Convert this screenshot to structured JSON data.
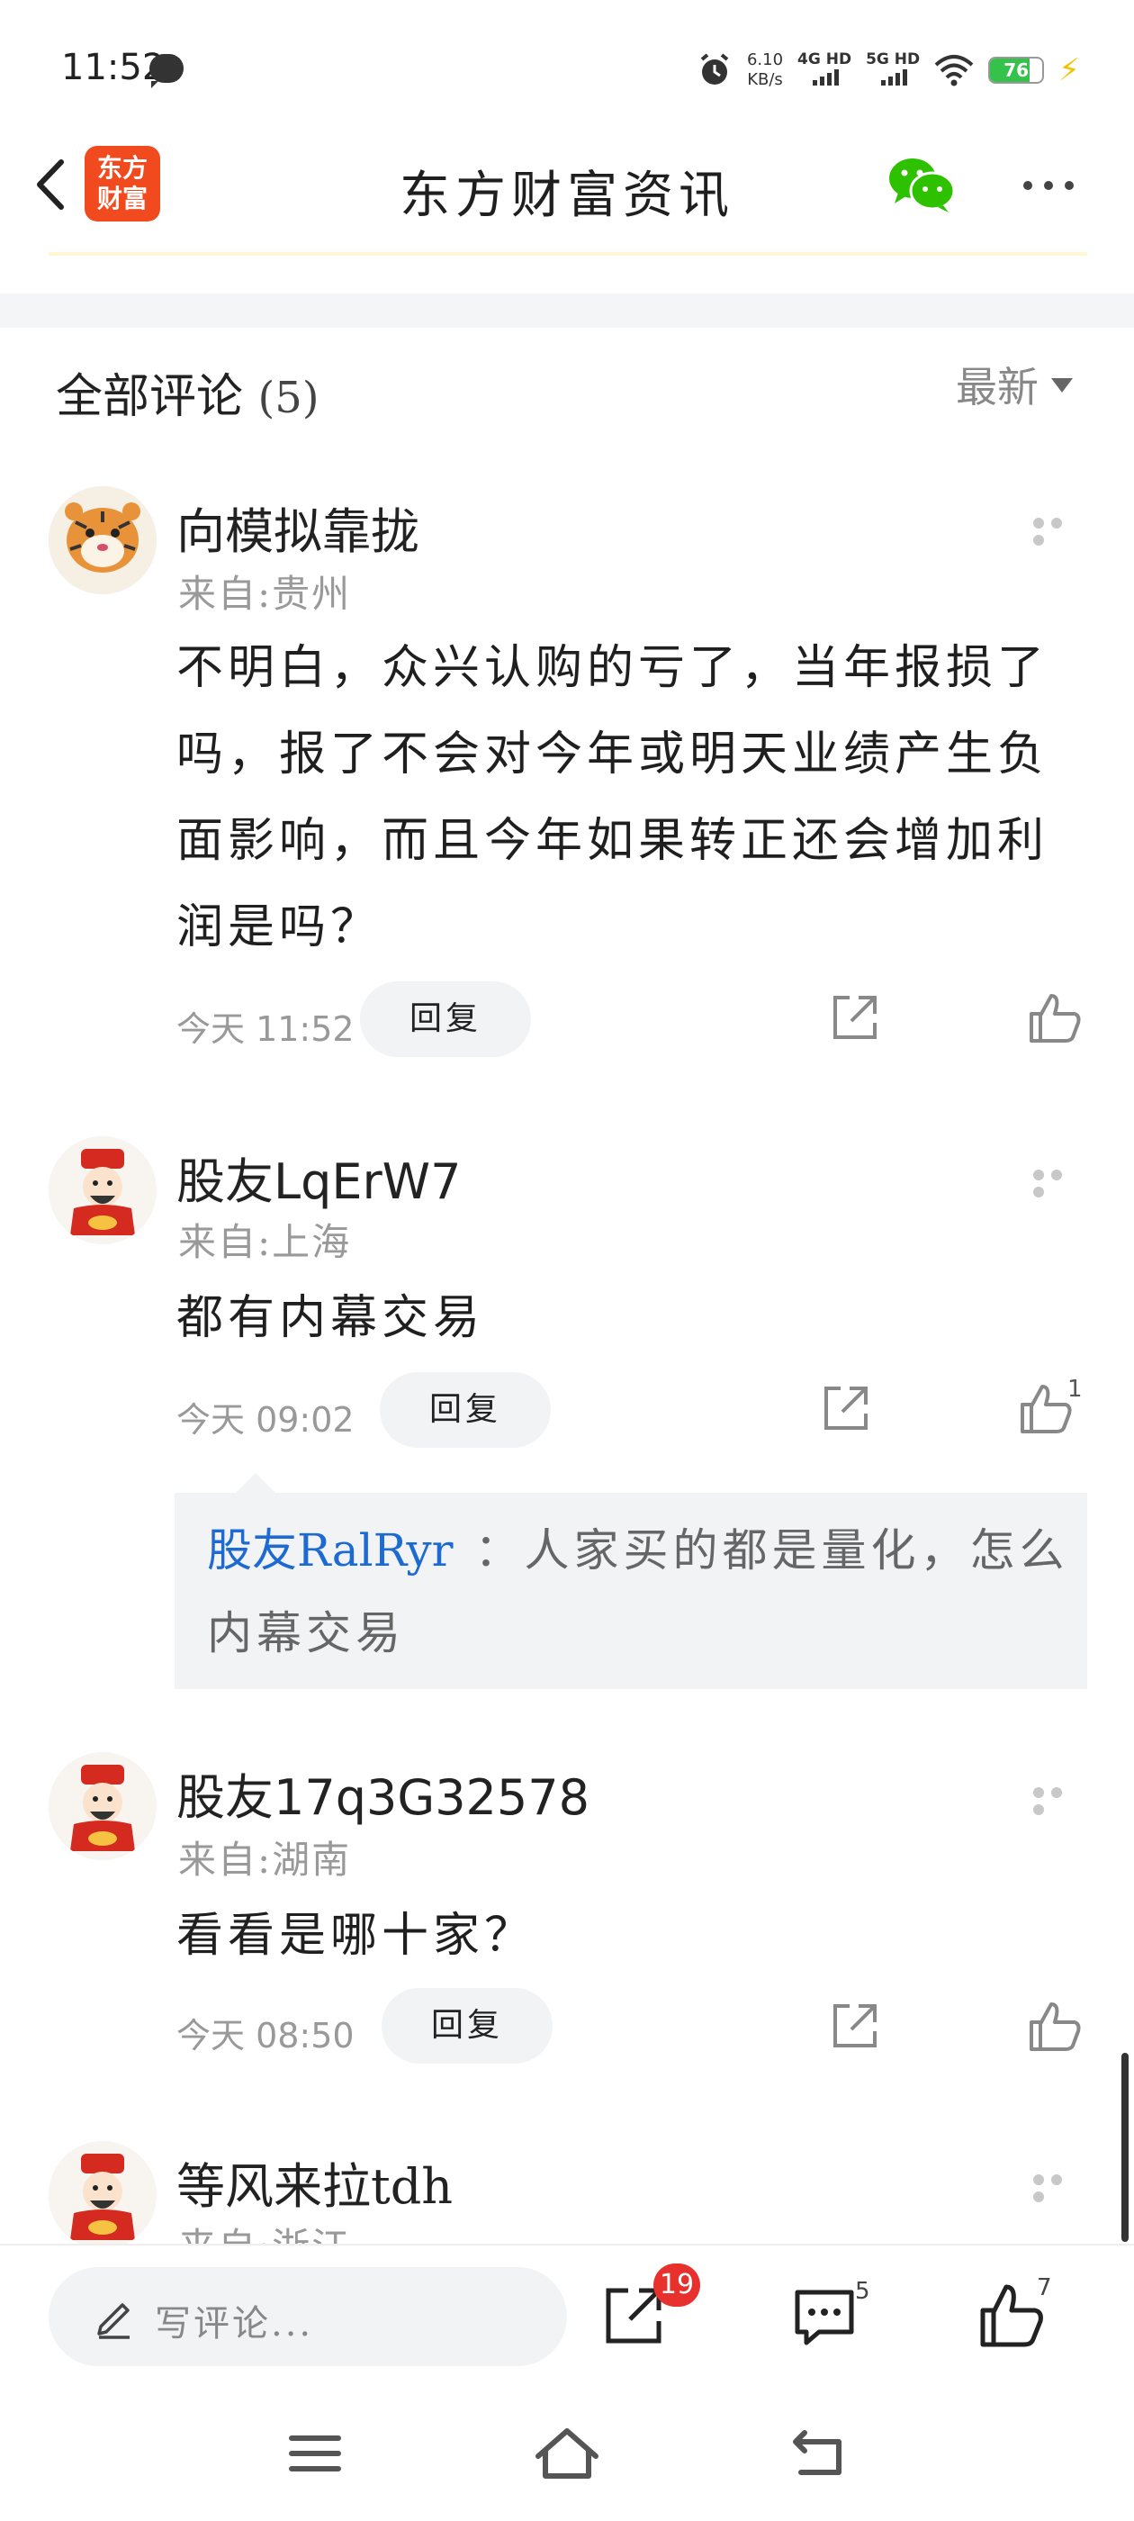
{
  "status_bar": {
    "time": "11:52",
    "net_speed": "6.10",
    "net_speed_unit": "KB/s",
    "net1": "4G HD",
    "net2": "5G HD",
    "battery": "76",
    "battery_level": 0.76
  },
  "header": {
    "logo_line1": "东方",
    "logo_line2": "财富",
    "title": "东方财富资讯",
    "icons": [
      "back-icon",
      "wechat-icon",
      "more-icon"
    ]
  },
  "comments_section": {
    "title": "全部评论",
    "count": "(5)",
    "sort": "最新"
  },
  "comments": [
    {
      "user": "向模拟靠拢",
      "location": "来自:贵州",
      "text": "不明白，众兴认购的亏了，当年报损了吗，报了不会对今年或明天业绩产生负面影响，而且今年如果转正还会增加利润是吗？",
      "time": "今天 11:52",
      "reply_label": "回复",
      "likes": ""
    },
    {
      "user": "股友LqErW7",
      "location": "来自:上海",
      "text": "都有内幕交易",
      "time": "今天 09:02",
      "reply_label": "回复",
      "likes": "1",
      "sub_reply": {
        "user": "股友RalRyr",
        "text": "：人家买的都是量化，怎么内幕交易"
      }
    },
    {
      "user": "股友17q3G32578",
      "location": "来自:湖南",
      "text": "看看是哪十家？",
      "time": "今天 08:50",
      "reply_label": "回复",
      "likes": ""
    },
    {
      "user": "等风来拉tdh",
      "location": "来自:浙江"
    }
  ],
  "bottom_bar": {
    "write_placeholder": "写评论...",
    "share_count": "19",
    "comment_count": "5",
    "like_count": "7"
  },
  "nav": {
    "icons": [
      "menu-icon",
      "home-icon",
      "back-nav-icon"
    ]
  },
  "colors": {
    "accent_red": "#e8302c",
    "logo_orange": "#f04a1e",
    "link_blue": "#1d6bd2",
    "wechat_green": "#2dc100"
  }
}
